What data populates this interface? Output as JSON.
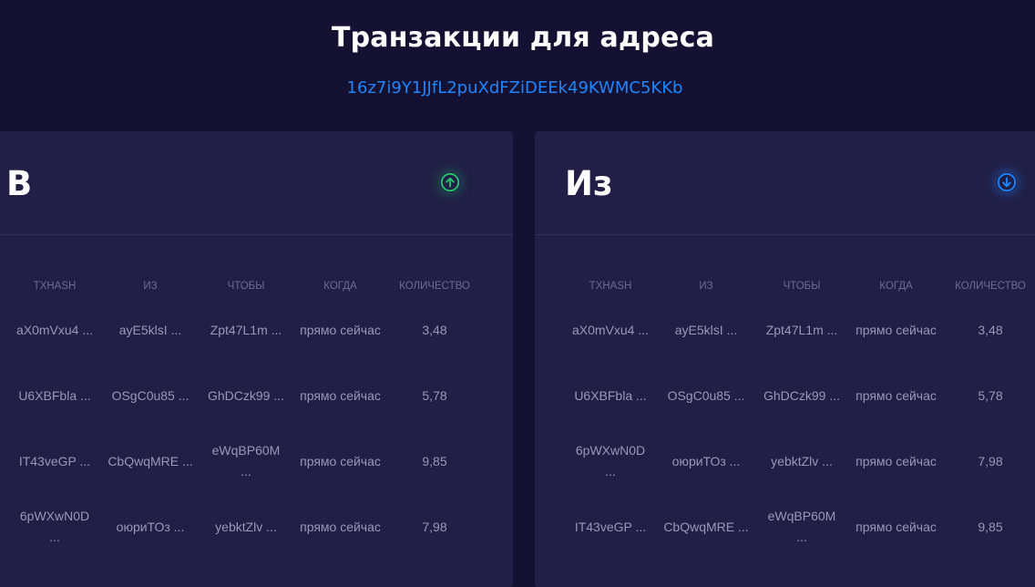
{
  "header": {
    "title": "Транзакции для адреса",
    "address": "16z7i9Y1JJfL2puXdFZiDEEk49KWMC5KKb"
  },
  "columns": [
    "TXHASH",
    "ИЗ",
    "ЧТОБЫ",
    "КОГДА",
    "КОЛИЧЕСТВО"
  ],
  "panel_in": {
    "title": "В",
    "icon": "arrow-up-circle-icon",
    "icon_color": "#24c86e",
    "rows": [
      {
        "txhash": "aX0mVxu4 ...",
        "from": "ayE5klsI ...",
        "to": "Zpt47L1m ...",
        "when": "прямо сейчас",
        "amount": "3,48"
      },
      {
        "txhash": "U6XBFbla ...",
        "from": "OSgC0u85 ...",
        "to": "GhDCzk99 ...",
        "when": "прямо сейчас",
        "amount": "5,78"
      },
      {
        "txhash": "IT43veGP ...",
        "from": "CbQwqMRE ...",
        "to": "eWqBP60M ...",
        "when": "прямо сейчас",
        "amount": "9,85"
      },
      {
        "txhash": "6pWXwN0D ...",
        "from": "оюриТОз ...",
        "to": "yebktZlv ...",
        "when": "прямо сейчас",
        "amount": "7,98"
      }
    ]
  },
  "panel_out": {
    "title": "Из",
    "icon": "arrow-down-circle-icon",
    "icon_color": "#1f86ff",
    "rows": [
      {
        "txhash": "aX0mVxu4 ...",
        "from": "ayE5klsI ...",
        "to": "Zpt47L1m ...",
        "when": "прямо сейчас",
        "amount": "3,48"
      },
      {
        "txhash": "U6XBFbla ...",
        "from": "OSgC0u85 ...",
        "to": "GhDCzk99 ...",
        "when": "прямо сейчас",
        "amount": "5,78"
      },
      {
        "txhash": "6pWXwN0D ...",
        "from": "оюриТОз ...",
        "to": "yebktZlv ...",
        "when": "прямо сейчас",
        "amount": "7,98"
      },
      {
        "txhash": "IT43veGP ...",
        "from": "CbQwqMRE ...",
        "to": "eWqBP60M ...",
        "when": "прямо сейчас",
        "amount": "9,85"
      }
    ]
  },
  "colors": {
    "background": "#141132",
    "panel": "#211f45",
    "address_link": "#1f86ff",
    "cell_text": "#9a97b8",
    "header_text": "#6e6b90"
  }
}
